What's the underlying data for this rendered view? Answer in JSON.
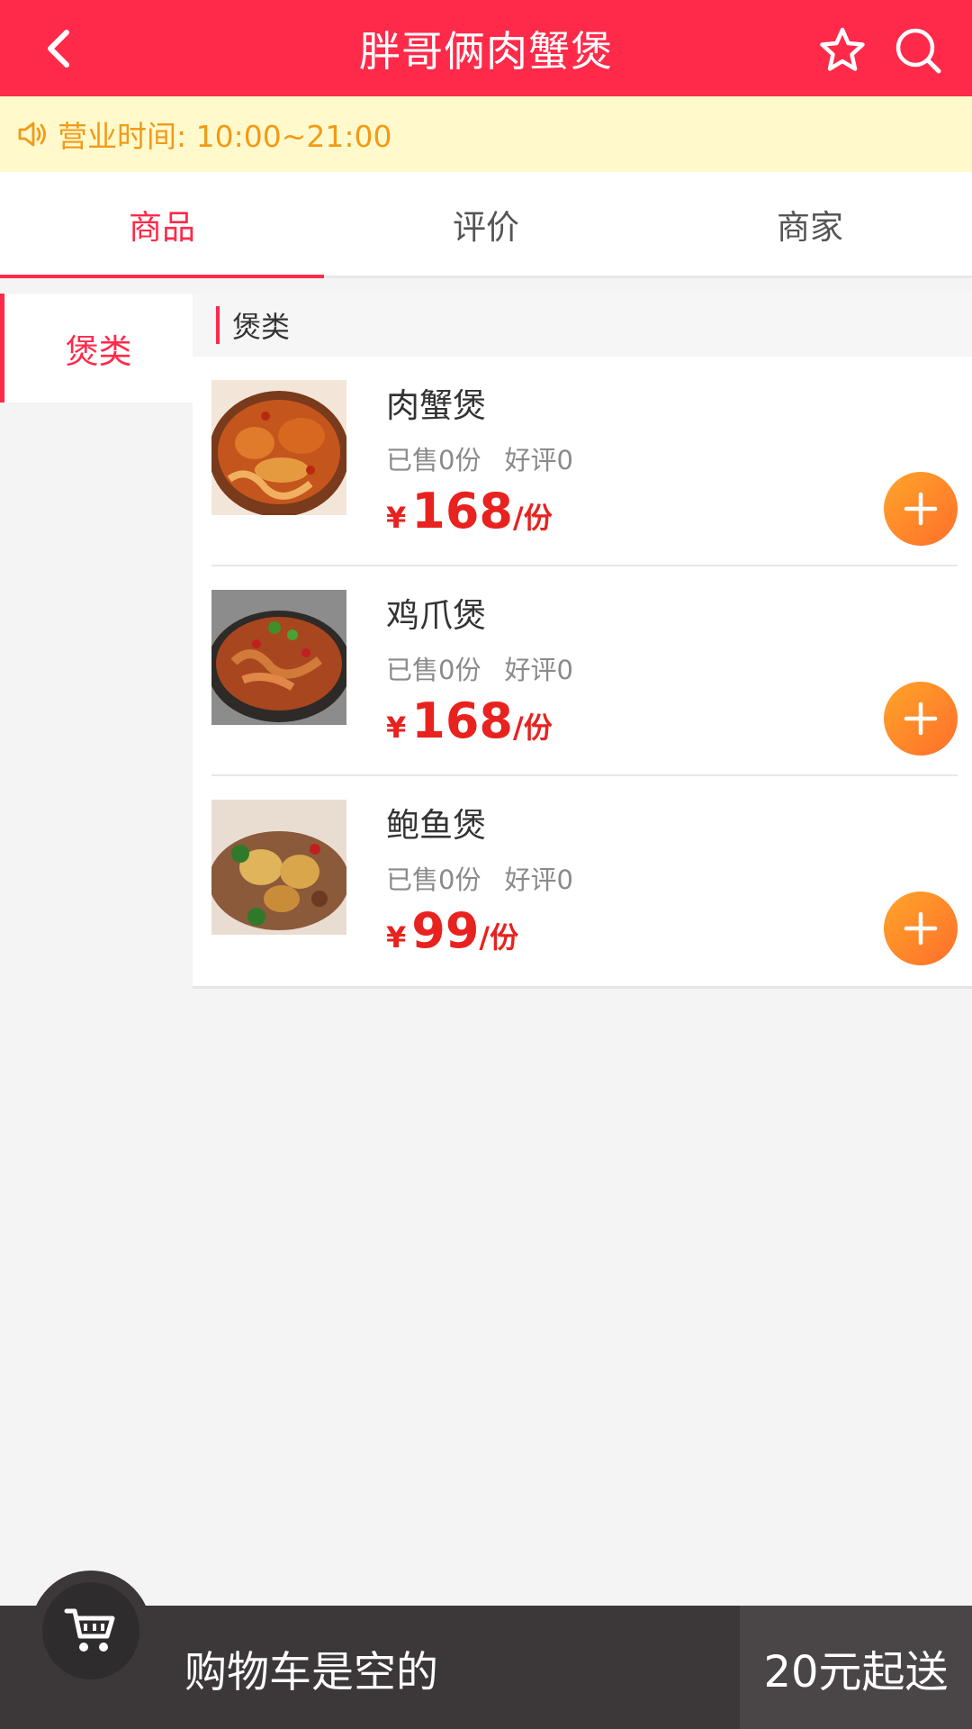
{
  "header": {
    "title": "胖哥俩肉蟹煲",
    "back_icon": "chevron-left-icon",
    "favorite_icon": "star-outline-icon",
    "search_icon": "search-icon"
  },
  "notice": {
    "icon": "speaker-icon",
    "text": "营业时间: 10:00~21:00"
  },
  "tabs": [
    {
      "label": "商品",
      "active": true
    },
    {
      "label": "评价",
      "active": false
    },
    {
      "label": "商家",
      "active": false
    }
  ],
  "sidebar": {
    "items": [
      {
        "label": "煲类",
        "active": true
      }
    ]
  },
  "category": {
    "label": "煲类"
  },
  "products": [
    {
      "name": "肉蟹煲",
      "sold": "已售0份",
      "rating": "好评0",
      "currency": "¥",
      "price": "168",
      "unit": "/份"
    },
    {
      "name": "鸡爪煲",
      "sold": "已售0份",
      "rating": "好评0",
      "currency": "¥",
      "price": "168",
      "unit": "/份"
    },
    {
      "name": "鲍鱼煲",
      "sold": "已售0份",
      "rating": "好评0",
      "currency": "¥",
      "price": "99",
      "unit": "/份"
    }
  ],
  "cart": {
    "icon": "cart-icon",
    "status": "购物车是空的",
    "min_order": "20元起送"
  },
  "colors": {
    "brand": "#ff2a4a",
    "price": "#e8221f",
    "notice_bg": "#fff9cc",
    "notice_text": "#f39a16",
    "add_button": "#ff8a2a",
    "cart_bar": "#3c3839"
  }
}
